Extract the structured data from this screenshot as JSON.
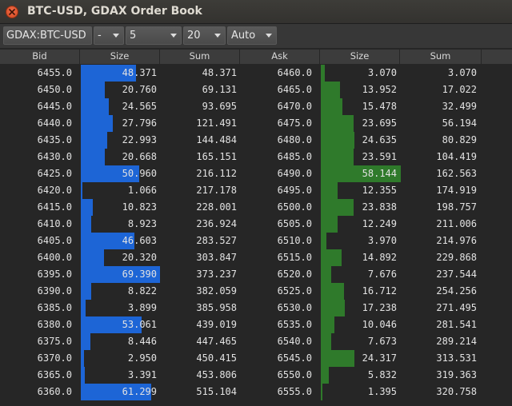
{
  "window": {
    "title": "BTC-USD, GDAX Order Book"
  },
  "toolbar": {
    "market": "GDAX:BTC-USD",
    "grouping": "-",
    "precision": "5",
    "depth": "20",
    "refresh": "Auto"
  },
  "columns": [
    "Bid",
    "Size",
    "Sum",
    "Ask",
    "Size",
    "Sum"
  ],
  "colors": {
    "bid_bar": "#1d65d6",
    "ask_bar": "#2f7a2b",
    "background": "#262626"
  },
  "rows": [
    {
      "bid": "6455.0",
      "bid_size": "48.371",
      "bid_sum": "48.371",
      "ask": "6460.0",
      "ask_size": "3.070",
      "ask_sum": "3.070"
    },
    {
      "bid": "6450.0",
      "bid_size": "20.760",
      "bid_sum": "69.131",
      "ask": "6465.0",
      "ask_size": "13.952",
      "ask_sum": "17.022"
    },
    {
      "bid": "6445.0",
      "bid_size": "24.565",
      "bid_sum": "93.695",
      "ask": "6470.0",
      "ask_size": "15.478",
      "ask_sum": "32.499"
    },
    {
      "bid": "6440.0",
      "bid_size": "27.796",
      "bid_sum": "121.491",
      "ask": "6475.0",
      "ask_size": "23.695",
      "ask_sum": "56.194"
    },
    {
      "bid": "6435.0",
      "bid_size": "22.993",
      "bid_sum": "144.484",
      "ask": "6480.0",
      "ask_size": "24.635",
      "ask_sum": "80.829"
    },
    {
      "bid": "6430.0",
      "bid_size": "20.668",
      "bid_sum": "165.151",
      "ask": "6485.0",
      "ask_size": "23.591",
      "ask_sum": "104.419"
    },
    {
      "bid": "6425.0",
      "bid_size": "50.960",
      "bid_sum": "216.112",
      "ask": "6490.0",
      "ask_size": "58.144",
      "ask_sum": "162.563"
    },
    {
      "bid": "6420.0",
      "bid_size": "1.066",
      "bid_sum": "217.178",
      "ask": "6495.0",
      "ask_size": "12.355",
      "ask_sum": "174.919"
    },
    {
      "bid": "6415.0",
      "bid_size": "10.823",
      "bid_sum": "228.001",
      "ask": "6500.0",
      "ask_size": "23.838",
      "ask_sum": "198.757"
    },
    {
      "bid": "6410.0",
      "bid_size": "8.923",
      "bid_sum": "236.924",
      "ask": "6505.0",
      "ask_size": "12.249",
      "ask_sum": "211.006"
    },
    {
      "bid": "6405.0",
      "bid_size": "46.603",
      "bid_sum": "283.527",
      "ask": "6510.0",
      "ask_size": "3.970",
      "ask_sum": "214.976"
    },
    {
      "bid": "6400.0",
      "bid_size": "20.320",
      "bid_sum": "303.847",
      "ask": "6515.0",
      "ask_size": "14.892",
      "ask_sum": "229.868"
    },
    {
      "bid": "6395.0",
      "bid_size": "69.390",
      "bid_sum": "373.237",
      "ask": "6520.0",
      "ask_size": "7.676",
      "ask_sum": "237.544"
    },
    {
      "bid": "6390.0",
      "bid_size": "8.822",
      "bid_sum": "382.059",
      "ask": "6525.0",
      "ask_size": "16.712",
      "ask_sum": "254.256"
    },
    {
      "bid": "6385.0",
      "bid_size": "3.899",
      "bid_sum": "385.958",
      "ask": "6530.0",
      "ask_size": "17.238",
      "ask_sum": "271.495"
    },
    {
      "bid": "6380.0",
      "bid_size": "53.061",
      "bid_sum": "439.019",
      "ask": "6535.0",
      "ask_size": "10.046",
      "ask_sum": "281.541"
    },
    {
      "bid": "6375.0",
      "bid_size": "8.446",
      "bid_sum": "447.465",
      "ask": "6540.0",
      "ask_size": "7.673",
      "ask_sum": "289.214"
    },
    {
      "bid": "6370.0",
      "bid_size": "2.950",
      "bid_sum": "450.415",
      "ask": "6545.0",
      "ask_size": "24.317",
      "ask_sum": "313.531"
    },
    {
      "bid": "6365.0",
      "bid_size": "3.391",
      "bid_sum": "453.806",
      "ask": "6550.0",
      "ask_size": "5.832",
      "ask_sum": "319.363"
    },
    {
      "bid": "6360.0",
      "bid_size": "61.299",
      "bid_sum": "515.104",
      "ask": "6555.0",
      "ask_size": "1.395",
      "ask_sum": "320.758"
    }
  ]
}
